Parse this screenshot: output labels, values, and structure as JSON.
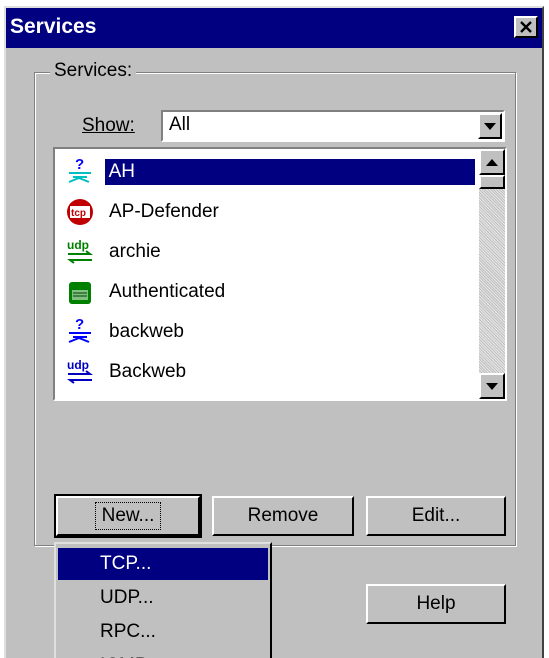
{
  "window": {
    "title": "Services"
  },
  "group": {
    "label": "Services:"
  },
  "show": {
    "label": "Show:",
    "value": "All"
  },
  "services": [
    {
      "label": "AH",
      "icon": "unknown-protocol-icon",
      "selected": true
    },
    {
      "label": "AP-Defender",
      "icon": "tcp-icon",
      "selected": false
    },
    {
      "label": "archie",
      "icon": "udp-icon",
      "selected": false
    },
    {
      "label": "Authenticated",
      "icon": "authenticated-icon",
      "selected": false
    },
    {
      "label": "backweb",
      "icon": "unknown-protocol-icon",
      "selected": false
    },
    {
      "label": "Backweb",
      "icon": "udp-icon",
      "selected": false
    }
  ],
  "buttons": {
    "new": "New...",
    "remove": "Remove",
    "edit": "Edit...",
    "help": "Help"
  },
  "new_menu": [
    "TCP...",
    "UDP...",
    "RPC...",
    "ICMP..."
  ],
  "colors": {
    "title_bar": "#000080",
    "selection": "#000080",
    "face": "#c0c0c0"
  }
}
